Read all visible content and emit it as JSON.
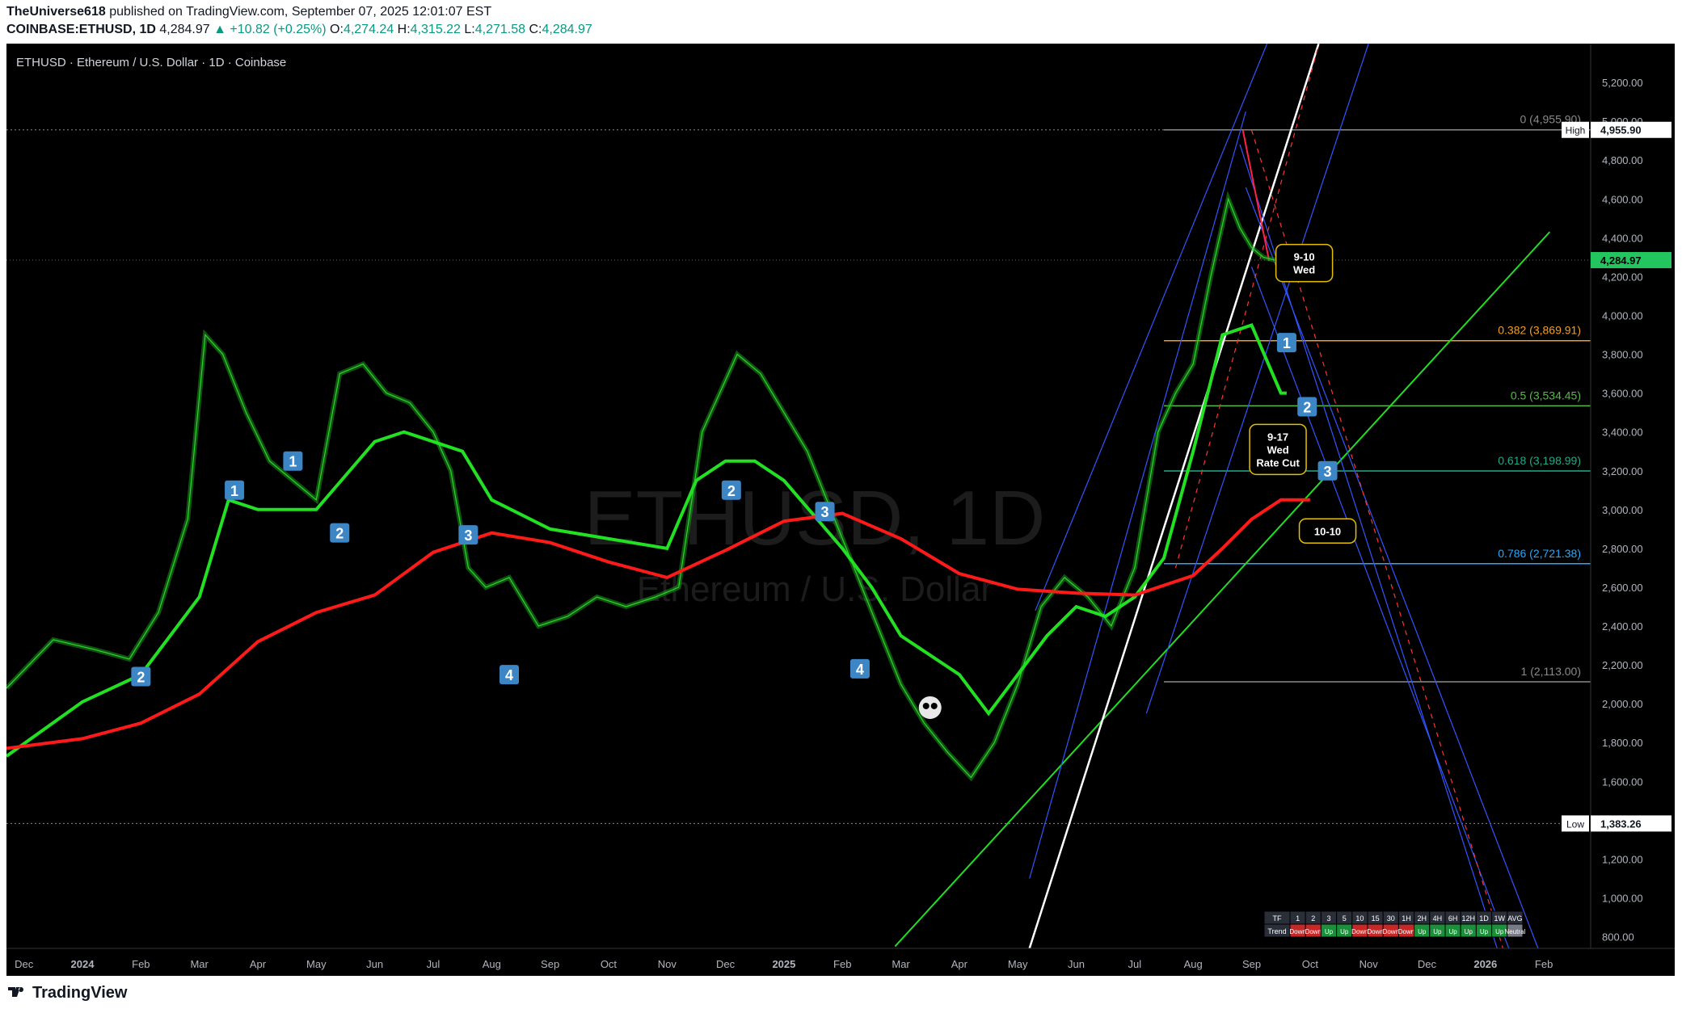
{
  "header": {
    "author": "TheUniverse618",
    "published": "published on TradingView.com, September 07, 2025 12:01:07 EST",
    "symbol": "COINBASE:ETHUSD, 1D",
    "last": "4,284.97",
    "change": "+10.82 (+0.25%)",
    "o_label": "O:",
    "o": "4,274.24",
    "h_label": "H:",
    "h": "4,315.22",
    "l_label": "L:",
    "l": "4,271.58",
    "c_label": "C:",
    "c": "4,284.97"
  },
  "legend_title": "ETHUSD · Ethereum / U.S. Dollar · 1D · Coinbase",
  "watermark": {
    "big": "ETHUSD, 1D",
    "small": "Ethereum / U.S. Dollar"
  },
  "footer": {
    "brand": "TradingView"
  },
  "chart_data": {
    "type": "line",
    "y_axis_ticks": [
      800,
      1000,
      1200,
      1400,
      1600,
      1800,
      2000,
      2200,
      2400,
      2600,
      2800,
      3000,
      3200,
      3400,
      3600,
      3800,
      4000,
      4200,
      4400,
      4600,
      4800,
      5000,
      5200
    ],
    "y_axis_tick_labels": [
      "800.00",
      "1,000.00",
      "1,200.00",
      "1,400.00",
      "1,600.00",
      "1,800.00",
      "2,000.00",
      "2,200.00",
      "2,400.00",
      "2,600.00",
      "2,800.00",
      "3,000.00",
      "3,200.00",
      "3,400.00",
      "3,600.00",
      "3,800.00",
      "4,000.00",
      "4,200.00",
      "4,400.00",
      "4,600.00",
      "4,800.00",
      "5,000.00",
      "5,200.00"
    ],
    "ylim": [
      740,
      5400
    ],
    "x_axis_labels": [
      {
        "label": "Dec",
        "t": 0
      },
      {
        "label": "2024",
        "t": 1
      },
      {
        "label": "Feb",
        "t": 2
      },
      {
        "label": "Mar",
        "t": 3
      },
      {
        "label": "Apr",
        "t": 4
      },
      {
        "label": "May",
        "t": 5
      },
      {
        "label": "Jun",
        "t": 6
      },
      {
        "label": "Jul",
        "t": 7
      },
      {
        "label": "Aug",
        "t": 8
      },
      {
        "label": "Sep",
        "t": 9
      },
      {
        "label": "Oct",
        "t": 10
      },
      {
        "label": "Nov",
        "t": 11
      },
      {
        "label": "Dec",
        "t": 12
      },
      {
        "label": "2025",
        "t": 13
      },
      {
        "label": "Feb",
        "t": 14
      },
      {
        "label": "Mar",
        "t": 15
      },
      {
        "label": "Apr",
        "t": 16
      },
      {
        "label": "May",
        "t": 17
      },
      {
        "label": "Jun",
        "t": 18
      },
      {
        "label": "Jul",
        "t": 19
      },
      {
        "label": "Aug",
        "t": 20
      },
      {
        "label": "Sep",
        "t": 21
      },
      {
        "label": "Oct",
        "t": 22
      },
      {
        "label": "Nov",
        "t": 23
      },
      {
        "label": "Dec",
        "t": 24
      },
      {
        "label": "2026",
        "t": 25
      },
      {
        "label": "Feb",
        "t": 26
      }
    ],
    "xlim": [
      -0.3,
      26.8
    ],
    "price": {
      "t": [
        -0.3,
        0.5,
        1.2,
        1.8,
        2.3,
        2.8,
        3.1,
        3.4,
        3.8,
        4.2,
        4.6,
        5.0,
        5.4,
        5.8,
        6.2,
        6.6,
        7.0,
        7.3,
        7.6,
        7.9,
        8.3,
        8.8,
        9.3,
        9.8,
        10.3,
        10.8,
        11.2,
        11.6,
        11.9,
        12.2,
        12.6,
        13.0,
        13.4,
        13.8,
        14.2,
        14.6,
        15.0,
        15.4,
        15.8,
        16.2,
        16.6,
        17.0,
        17.4,
        17.8,
        18.2,
        18.6,
        19.0,
        19.4,
        19.7,
        20.0,
        20.3,
        20.6,
        20.8,
        21.0,
        21.2,
        21.4
      ],
      "close": [
        2080,
        2330,
        2280,
        2230,
        2470,
        2950,
        3900,
        3800,
        3500,
        3250,
        3150,
        3050,
        3700,
        3750,
        3600,
        3550,
        3400,
        3200,
        2700,
        2600,
        2650,
        2400,
        2450,
        2550,
        2500,
        2550,
        2600,
        3400,
        3600,
        3800,
        3700,
        3500,
        3300,
        3000,
        2700,
        2400,
        2100,
        1900,
        1750,
        1620,
        1800,
        2100,
        2500,
        2650,
        2550,
        2400,
        2700,
        3400,
        3600,
        3750,
        4200,
        4600,
        4450,
        4350,
        4300,
        4285
      ]
    },
    "series": [
      {
        "name": "",
        "color": "#22e022",
        "t": [
          -0.3,
          1,
          2,
          3,
          3.5,
          4,
          5,
          6,
          6.5,
          7,
          7.5,
          8,
          9,
          10,
          11,
          11.5,
          12,
          12.5,
          13,
          14,
          14.5,
          15,
          16,
          16.5,
          17,
          17.5,
          18,
          18.5,
          19,
          19.5,
          20,
          20.5,
          21,
          21.5,
          21.6
        ],
        "values": [
          1730,
          2010,
          2150,
          2550,
          3050,
          3000,
          3000,
          3350,
          3400,
          3350,
          3300,
          3050,
          2900,
          2850,
          2800,
          3150,
          3250,
          3250,
          3150,
          2800,
          2600,
          2350,
          2150,
          1950,
          2150,
          2350,
          2500,
          2450,
          2550,
          2750,
          3300,
          3900,
          3950,
          3600,
          3600
        ]
      },
      {
        "name": "",
        "color": "#ff1a1a",
        "t": [
          -0.3,
          1,
          2,
          3,
          4,
          5,
          6,
          7,
          8,
          9,
          10,
          11,
          12,
          13,
          14,
          15,
          16,
          17,
          18,
          19,
          20,
          20.5,
          21,
          21.5,
          22
        ],
        "values": [
          1770,
          1820,
          1900,
          2050,
          2320,
          2470,
          2560,
          2780,
          2880,
          2830,
          2730,
          2650,
          2790,
          2940,
          2980,
          2850,
          2670,
          2590,
          2570,
          2560,
          2660,
          2800,
          2950,
          3050,
          3050
        ]
      }
    ],
    "levels": [
      {
        "label": "0 (4,955.90)",
        "value": 4955.9,
        "color": "#8a8a8a"
      },
      {
        "label": "0.382 (3,869.91)",
        "value": 3869.91,
        "color": "#f0a020"
      },
      {
        "label": "0.5 (3,534.45)",
        "value": 3534.45,
        "color": "#55bb44"
      },
      {
        "label": "0.618 (3,198.99)",
        "value": 3198.99,
        "color": "#22aa88"
      },
      {
        "label": "0.786 (2,721.38)",
        "value": 2721.38,
        "color": "#22aaff"
      },
      {
        "label": "1 (2,113.00)",
        "value": 2113.0,
        "color": "#8a8a8a"
      }
    ],
    "price_tags": [
      {
        "text": "High",
        "value_text": "4,955.90",
        "value": 4955.9,
        "bg": "#ffffff",
        "fg": "#131722"
      },
      {
        "text": "",
        "value_text": "4,284.97",
        "value": 4284.97,
        "bg": "#22c55e",
        "fg": "#000000"
      },
      {
        "text": "Low",
        "value_text": "1,383.26",
        "value": 1383.26,
        "bg": "#ffffff",
        "fg": "#131722"
      }
    ],
    "wave_markers": [
      {
        "label": "1",
        "t": 3.6,
        "v": 3100
      },
      {
        "label": "1",
        "t": 4.6,
        "v": 3250
      },
      {
        "label": "2",
        "t": 5.4,
        "v": 2880
      },
      {
        "label": "2",
        "t": 2.0,
        "v": 2140
      },
      {
        "label": "3",
        "t": 7.6,
        "v": 2870
      },
      {
        "label": "4",
        "t": 8.3,
        "v": 2150
      },
      {
        "label": "2",
        "t": 12.1,
        "v": 3100
      },
      {
        "label": "3",
        "t": 13.7,
        "v": 2990
      },
      {
        "label": "4",
        "t": 14.3,
        "v": 2180
      },
      {
        "label": "1",
        "t": 21.6,
        "v": 3860
      },
      {
        "label": "2",
        "t": 21.95,
        "v": 3530
      },
      {
        "label": "3",
        "t": 22.3,
        "v": 3200
      }
    ],
    "annotations": [
      {
        "text": "9-10\nWed",
        "t": 21.9,
        "v": 4270
      },
      {
        "text": "9-17\nWed\nRate Cut",
        "t": 21.45,
        "v": 3310
      },
      {
        "text": "10-10",
        "t": 22.3,
        "v": 2890
      }
    ],
    "trend_table": {
      "headers": [
        "TF",
        "1",
        "2",
        "3",
        "5",
        "10",
        "15",
        "30",
        "1H",
        "2H",
        "4H",
        "6H",
        "12H",
        "1D",
        "1W",
        "AVG"
      ],
      "row_label": "Trend",
      "values": [
        "Down",
        "Down",
        "Up",
        "Up",
        "Down",
        "Down",
        "Down",
        "Down",
        "Up",
        "Up",
        "Up",
        "Up",
        "Up",
        "Up",
        "Neutral"
      ]
    }
  }
}
